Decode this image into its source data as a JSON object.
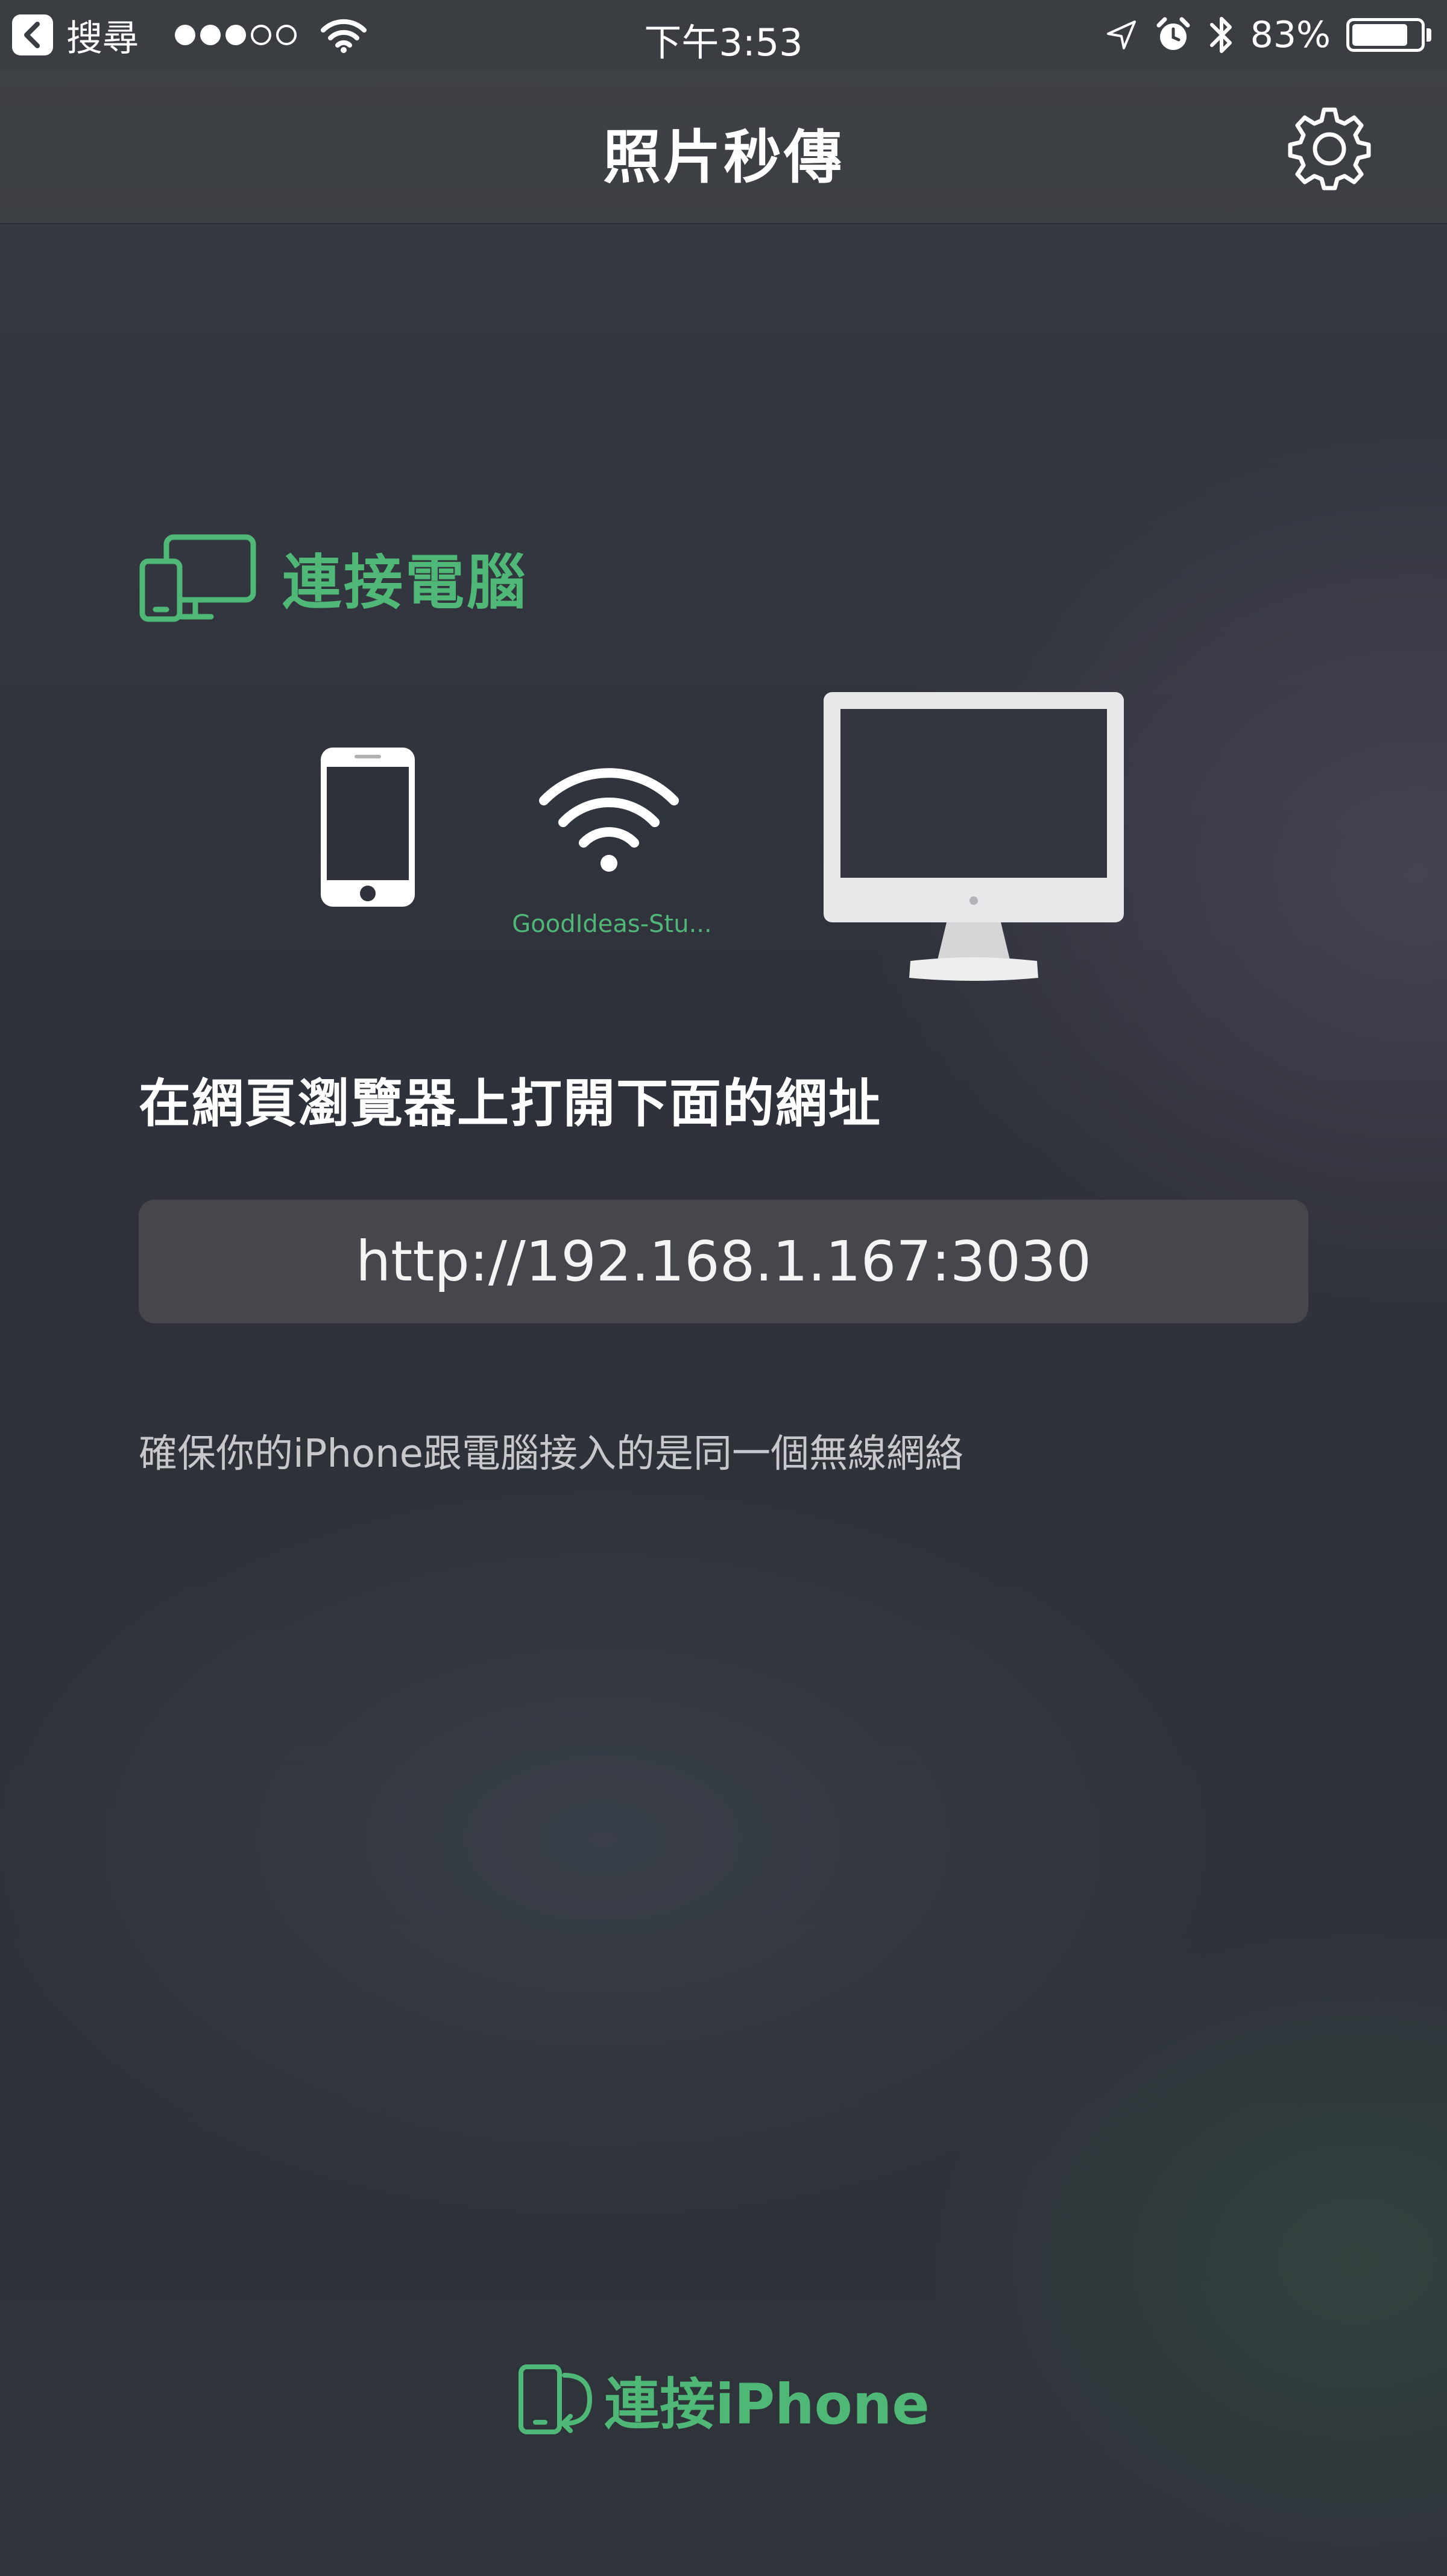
{
  "status_bar": {
    "back_label": "搜尋",
    "time": "下午3:53",
    "battery_percent": "83%",
    "battery_level": 0.83
  },
  "nav": {
    "title": "照片秒傳"
  },
  "connect": {
    "heading": "連接電腦",
    "ssid": "GoodIdeas-Stu...",
    "instruction": "在網頁瀏覽器上打開下面的網址",
    "url": "http://192.168.1.167:3030",
    "note": "確保你的iPhone跟電腦接入的是同一個無線網絡"
  },
  "footer": {
    "connect_iphone": "連接iPhone"
  },
  "colors": {
    "accent": "#4fb877",
    "background": "#30333b",
    "nav_bar": "#3e4146",
    "url_box": "#45474d"
  },
  "icons": {
    "back": "chevron-left-icon",
    "signal": "signal-dots-icon",
    "wifi": "wifi-icon",
    "location": "location-arrow-icon",
    "alarm": "alarm-icon",
    "bluetooth": "bluetooth-icon",
    "battery": "battery-icon",
    "settings": "gear-icon",
    "devices": "devices-icon",
    "phone": "smartphone-icon",
    "monitor": "monitor-icon"
  }
}
